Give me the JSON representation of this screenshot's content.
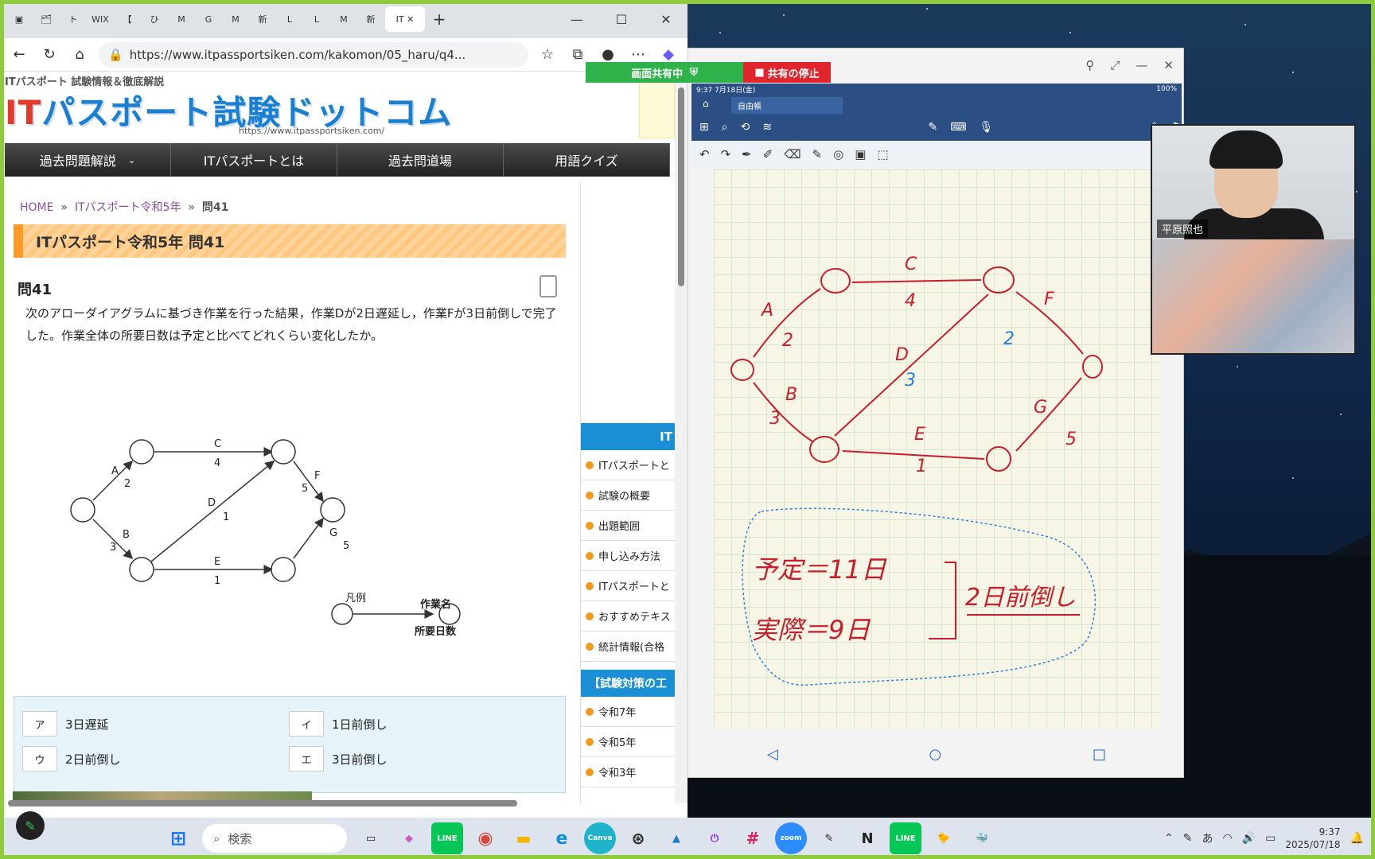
{
  "browser": {
    "tabs": [
      "🗂",
      "ト",
      "WIX",
      "【",
      "ひ",
      "M",
      "G",
      "M",
      "新",
      "L",
      "L",
      "M",
      "新",
      "IT"
    ],
    "active_tab_label": "IT",
    "url": "https://www.itpassportsiken.com/kakomon/05_haru/q4...",
    "window_controls": {
      "minimize": "—",
      "maximize": "☐",
      "close": "✕"
    }
  },
  "site": {
    "tagline": "ITパスポート 試験情報＆徹底解説",
    "logo_it": "IT",
    "logo_rest": "パスポート試験ドットコム",
    "site_url": "https://www.itpassportsiken.com/",
    "nav": [
      "過去問題解説",
      "ITパスポートとは",
      "過去問道場",
      "用語クイズ"
    ],
    "breadcrumb": {
      "home": "HOME",
      "sep": "»",
      "year": "ITパスポート令和5年",
      "current": "問41"
    },
    "heading": "ITパスポート令和5年 問41",
    "question_no": "問41",
    "question_text": "次のアローダイアグラムに基づき作業を行った結果，作業Dが2日遅延し，作業Fが3日前倒しで完了した。作業全体の所要日数は予定と比べてどれくらい変化したか。",
    "legend": {
      "label": "凡例",
      "task_name": "作業名",
      "duration": "所要日数"
    },
    "choices": [
      {
        "key": "ア",
        "text": "3日遅延"
      },
      {
        "key": "イ",
        "text": "1日前倒し"
      },
      {
        "key": "ウ",
        "text": "2日前倒し"
      },
      {
        "key": "エ",
        "text": "3日前倒し"
      }
    ]
  },
  "diagram": {
    "tasks": [
      {
        "name": "A",
        "days": "2"
      },
      {
        "name": "B",
        "days": "3"
      },
      {
        "name": "C",
        "days": "4"
      },
      {
        "name": "D",
        "days": "1"
      },
      {
        "name": "E",
        "days": "1"
      },
      {
        "name": "F",
        "days": "5"
      },
      {
        "name": "G",
        "days": "5"
      }
    ]
  },
  "sidebar": {
    "header1": "IT",
    "items1": [
      "ITパスポートと",
      "試験の概要",
      "出題範囲",
      "申し込み方法",
      "ITパスポートと",
      "おすすめテキス",
      "統計情報(合格"
    ],
    "header2": "【試験対策の工",
    "items2": [
      "令和7年",
      "令和5年",
      "令和3年"
    ]
  },
  "sharebar": {
    "sharing": "画面共有中",
    "stop": "共有の停止"
  },
  "tablet": {
    "status_time": "9:37  7月18日(金)",
    "status_right": "100%",
    "note_tab": "自由帳",
    "handwriting": {
      "tasks": [
        {
          "name": "A",
          "days": "2"
        },
        {
          "name": "B",
          "days": "3"
        },
        {
          "name": "C",
          "days": "4"
        },
        {
          "name": "D",
          "days": "3"
        },
        {
          "name": "E",
          "days": "1"
        },
        {
          "name": "F",
          "days": "2"
        },
        {
          "name": "G",
          "days": "5"
        }
      ],
      "plan": "予定＝11日",
      "actual": "実際＝9日",
      "conclusion": "2日前倒し"
    }
  },
  "video": {
    "participant_name": "平原照也"
  },
  "taskbar": {
    "search_placeholder": "検索",
    "apps": [
      "⊞",
      "🗀",
      "◆",
      "LINE",
      "◉",
      "📁",
      "e",
      "Canva",
      "⊛",
      "▲",
      "⏻",
      "#",
      "zoom",
      "✎",
      "N",
      "LINE",
      "🐤",
      "🐳"
    ],
    "ime": "あ",
    "time": "9:37",
    "date": "2025/07/18"
  },
  "colors": {
    "accent_blue": "#1b8fd4",
    "share_green": "#2db34a",
    "share_red": "#e0262c",
    "ink_red": "#c81e2a",
    "ink_blue": "#2a7fd6"
  }
}
